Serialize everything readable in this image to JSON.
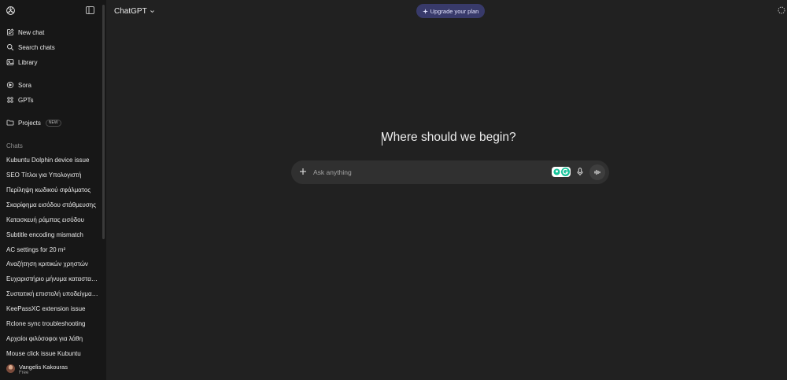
{
  "sidebar": {
    "nav": [
      {
        "label": "New chat",
        "icon": "compose-icon"
      },
      {
        "label": "Search chats",
        "icon": "search-icon"
      },
      {
        "label": "Library",
        "icon": "library-icon"
      },
      {
        "label": "Sora",
        "icon": "sora-icon"
      },
      {
        "label": "GPTs",
        "icon": "gpts-icon"
      },
      {
        "label": "Projects",
        "icon": "folder-icon",
        "badge": "NEW"
      }
    ],
    "chats_heading": "Chats",
    "chats": [
      "Kubuntu Dolphin device issue",
      "SEO Τίτλοι για Υπολογιστή",
      "Περίληψη κωδικού σφάλματος",
      "Σκαρίφημα εισόδου στάθμευσης",
      "Κατασκευή ράμπας εισόδου",
      "Subtitle encoding mismatch",
      "AC settings for 20 m²",
      "Αναζήτηση κριτικών χρηστών",
      "Ευχαριστήριο μήνυμα κατασταστήματος",
      "Συστατική επιστολή υποδείγματος",
      "KeePassXC extension issue",
      "Rclone sync troubleshooting",
      "Αρχαίοι φιλόσοφοι για λάθη",
      "Mouse click issue Kubuntu"
    ],
    "user": {
      "name": "Vangelis Kakouras",
      "plan": "Free"
    }
  },
  "header": {
    "model": "ChatGPT",
    "upgrade_label": "Upgrade your plan"
  },
  "main": {
    "headline": "Where should we begin?",
    "composer_placeholder": "Ask anything"
  },
  "colors": {
    "sidebar_bg": "#171717",
    "main_bg": "#212121",
    "composer_bg": "#303030",
    "upgrade_bg": "#383a6a",
    "grammarly_green": "#15c39a"
  }
}
